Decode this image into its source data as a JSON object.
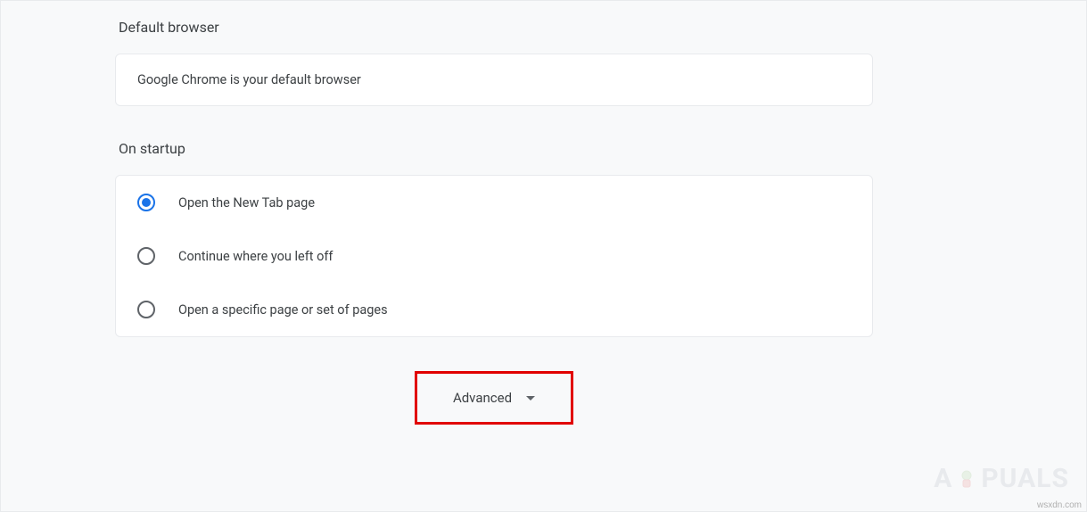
{
  "sections": {
    "default_browser": {
      "title": "Default browser",
      "status": "Google Chrome is your default browser"
    },
    "on_startup": {
      "title": "On startup",
      "options": [
        {
          "label": "Open the New Tab page",
          "selected": true
        },
        {
          "label": "Continue where you left off",
          "selected": false
        },
        {
          "label": "Open a specific page or set of pages",
          "selected": false
        }
      ]
    }
  },
  "footer": {
    "advanced_label": "Advanced"
  },
  "watermark": {
    "prefix": "A",
    "suffix": "PUALS"
  },
  "source": "wsxdn.com"
}
